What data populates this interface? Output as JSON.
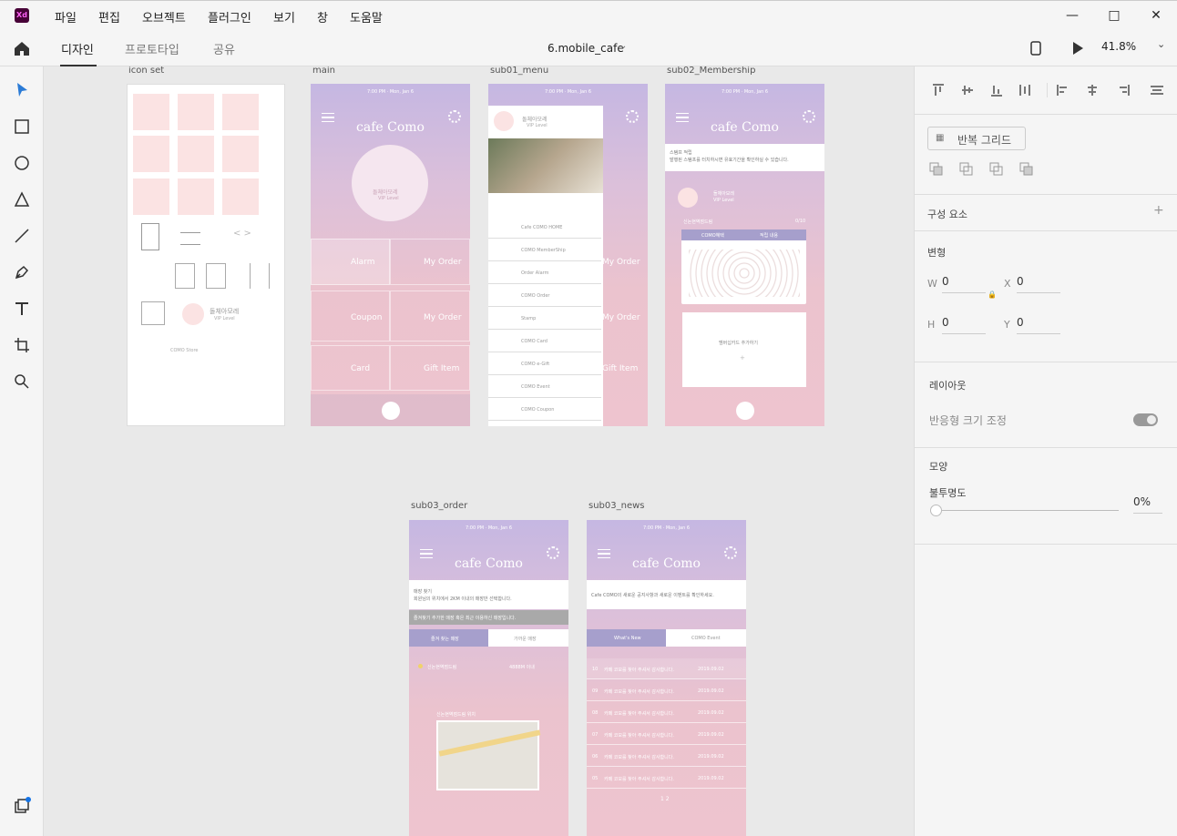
{
  "app": {
    "logo": "Xd",
    "menus": [
      "파일",
      "편집",
      "오브젝트",
      "플러그인",
      "보기",
      "창",
      "도움말"
    ],
    "tabs": [
      "디자인",
      "프로토타입",
      "공유"
    ],
    "doc_title": "6.mobile_cafe",
    "zoom": "41.8%"
  },
  "panel": {
    "repeat_grid": "반복 그리드",
    "components": "구성 요소",
    "transform": "변형",
    "w_label": "W",
    "w_value": "0",
    "h_label": "H",
    "h_value": "0",
    "x_label": "X",
    "x_value": "0",
    "y_label": "Y",
    "y_value": "0",
    "layout": "레이아웃",
    "responsive": "반응형 크기 조정",
    "appearance": "모양",
    "opacity_label": "불투명도",
    "opacity_value": "0%"
  },
  "artboards": {
    "icon_set": {
      "label": "icon set",
      "user_name": "돌체아모레",
      "user_level": "VIP Level",
      "store": "COMO Store"
    },
    "main": {
      "label": "main",
      "status": "7:00 PM · Mon, Jan 6",
      "brand": "cafe Como",
      "user_name": "돌체아모레",
      "user_level": "VIP Level",
      "tiles": [
        "Alarm",
        "My Order",
        "Coupon",
        "My Order",
        "Card",
        "Gift Item"
      ]
    },
    "sub01": {
      "label": "sub01_menu",
      "status": "7:00 PM · Mon, Jan 6",
      "user_name": "돌체아모레",
      "user_level": "VIP Level",
      "menu": [
        "Cafe COMO HOME",
        "COMO MemberShip",
        "Order Alarm",
        "COMO Order",
        "Stamp",
        "COMO Card",
        "COMO e-Gift",
        "COMO Event",
        "COMO Coupon"
      ],
      "tiles": [
        "My Order",
        "My Order",
        "Gift Item"
      ]
    },
    "sub02": {
      "label": "sub02_Membership",
      "status": "7:00 PM · Mon, Jan 6",
      "brand": "cafe Como",
      "notice1": "스탬프 적립",
      "notice2": "발행된 스탬프를 터치하시면 유효기간을 확인하실 수 있습니다.",
      "user_name": "돌체아모레",
      "user_level": "VIP Level",
      "store": "신논현역점드림",
      "count": "0/10",
      "tab_a": "COMO혜택",
      "tab_b": "적립 내용",
      "add_card": "멤버십카드 추가하기",
      "plus": "+"
    },
    "sub03_order": {
      "label": "sub03_order",
      "status": "7:00 PM · Mon, Jan 6",
      "brand": "cafe Como",
      "line1": "매장 찾기",
      "line2": "회원님의 위치에서 2KM 이내의 매장만 선택합니다.",
      "bar": "즐겨찾기 추가한 매장 혹은 최근 이용하신 매장입니다.",
      "tab_a": "즐겨 찾는 매장",
      "tab_b": "가까운 매장",
      "store": "신논현역점드림",
      "distance": "4888M 이내",
      "map_title": "신논현역점드림 위치"
    },
    "sub03_news": {
      "label": "sub03_news",
      "status": "7:00 PM · Mon, Jan 6",
      "brand": "cafe Como",
      "intro": "Cafe COMO의 새로운 공지사항과 새로운 이벤트를 확인하세요.",
      "tab_a": "What's New",
      "tab_b": "COMO Event",
      "rows": [
        {
          "no": "10",
          "text": "카페 코모를 찾아 주셔서 감사합니다.",
          "date": "2019.09.02"
        },
        {
          "no": "09",
          "text": "카페 코모를 찾아 주셔서 감사합니다.",
          "date": "2019.09.02"
        },
        {
          "no": "08",
          "text": "카페 코모를 찾아 주셔서 감사합니다.",
          "date": "2019.09.02"
        },
        {
          "no": "07",
          "text": "카페 코모를 찾아 주셔서 감사합니다.",
          "date": "2019.09.02"
        },
        {
          "no": "06",
          "text": "카페 코모를 찾아 주셔서 감사합니다.",
          "date": "2019.09.02"
        },
        {
          "no": "05",
          "text": "카페 코모를 찾아 주셔서 감사합니다.",
          "date": "2019.09.02"
        }
      ],
      "pager": "1  2"
    }
  }
}
